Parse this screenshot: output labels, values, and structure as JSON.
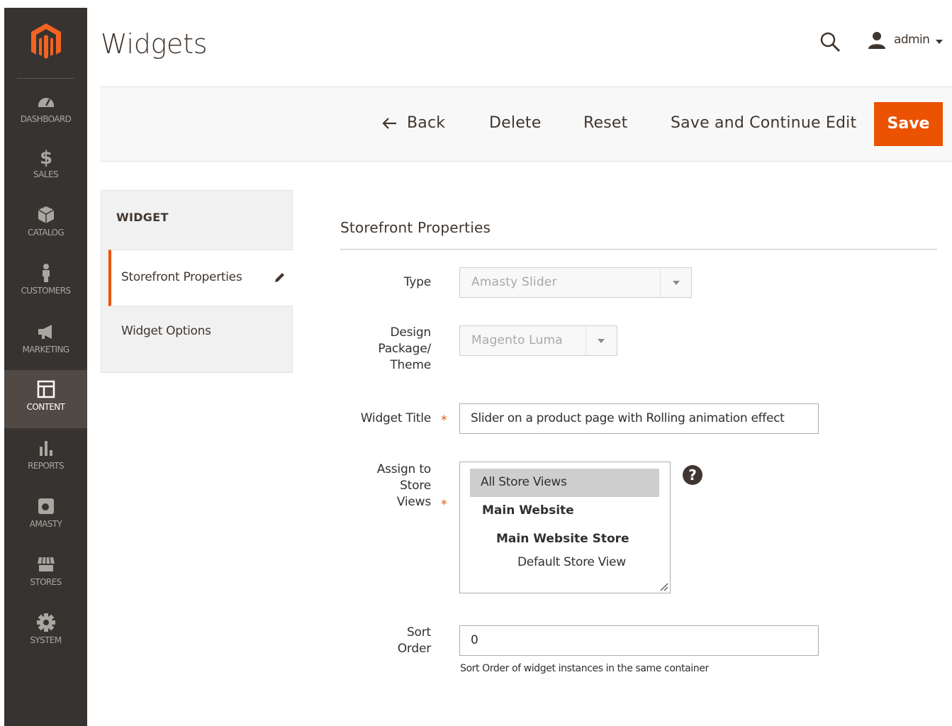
{
  "sidebar": {
    "items": [
      {
        "label": "DASHBOARD",
        "icon": "dashboard-icon"
      },
      {
        "label": "SALES",
        "icon": "dollar-icon"
      },
      {
        "label": "CATALOG",
        "icon": "box-icon"
      },
      {
        "label": "CUSTOMERS",
        "icon": "person-icon"
      },
      {
        "label": "MARKETING",
        "icon": "megaphone-icon"
      },
      {
        "label": "CONTENT",
        "icon": "layout-icon"
      },
      {
        "label": "REPORTS",
        "icon": "bar-chart-icon"
      },
      {
        "label": "AMASTY",
        "icon": "amasty-icon"
      },
      {
        "label": "STORES",
        "icon": "store-icon"
      },
      {
        "label": "SYSTEM",
        "icon": "gear-icon"
      }
    ]
  },
  "header": {
    "title": "Widgets",
    "user": "admin"
  },
  "toolbar": {
    "back": "Back",
    "delete": "Delete",
    "reset": "Reset",
    "save_continue": "Save and Continue Edit",
    "save": "Save"
  },
  "tabs": {
    "title": "WIDGET",
    "items": [
      "Storefront Properties",
      "Widget Options"
    ]
  },
  "form": {
    "section_title": "Storefront Properties",
    "type_label": "Type",
    "type_value": "Amasty Slider",
    "design_label_1": "Design",
    "design_label_2": "Package/",
    "design_label_3": "Theme",
    "design_value": "Magento Luma",
    "title_label": "Widget Title",
    "title_value": "Slider on a product page with Rolling animation effect",
    "assign_label_1": "Assign to",
    "assign_label_2": "Store",
    "assign_label_3": "Views",
    "store_options": [
      "All Store Views",
      "Main Website",
      "Main Website Store",
      "Default Store View"
    ],
    "sort_label_1": "Sort",
    "sort_label_2": "Order",
    "sort_value": "0",
    "sort_note": "Sort Order of widget instances in the same container",
    "required_mark": "*"
  },
  "colors": {
    "accent": "#eb5202",
    "sidebar": "#373330",
    "sidebar_active": "#514943"
  }
}
